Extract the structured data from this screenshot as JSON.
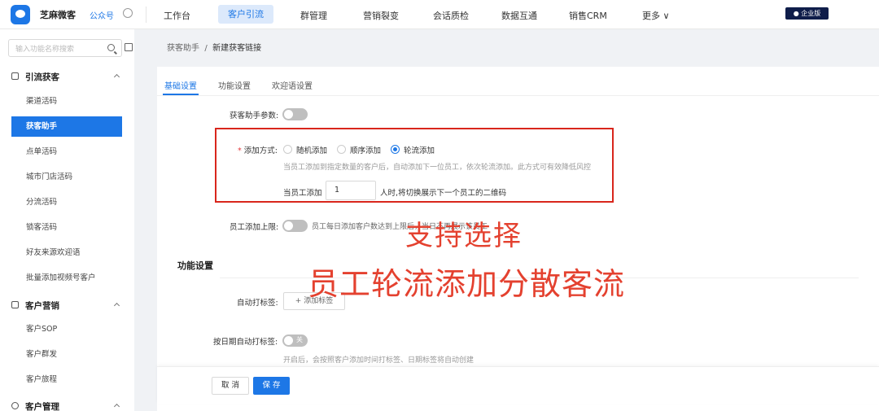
{
  "topbar": {
    "brand": "芝麻微客",
    "gzh": "公众号",
    "nav": [
      "工作台",
      "客户引流",
      "群管理",
      "营销裂变",
      "会话质检",
      "数据互通",
      "销售CRM",
      "更多 ∨"
    ],
    "badge": "企业版"
  },
  "sidebar": {
    "search_placeholder": "输入功能名称搜索",
    "group1": "引流获客",
    "group1_items": [
      "渠道活码",
      "获客助手",
      "点单活码",
      "城市门店活码",
      "分流活码",
      "锁客活码",
      "好友来源欢迎语",
      "批量添加视频号客户"
    ],
    "group2": "客户营销",
    "group2_items": [
      "客户SOP",
      "客户群发",
      "客户旅程"
    ],
    "group3": "客户管理"
  },
  "breadcrumb": {
    "parent": "获客助手",
    "sep": "/",
    "current": "新建获客链接"
  },
  "tabs": [
    "基础设置",
    "功能设置",
    "欢迎语设置"
  ],
  "form": {
    "param_label": "获客助手参数:",
    "add_mode_label": "添加方式:",
    "add_mode_options": [
      "随机添加",
      "顺序添加",
      "轮流添加"
    ],
    "add_mode_hint": "当员工添加到指定数量的客户后，自动添加下一位员工，依次轮流添加。此方式可有效降低风控",
    "switch_prefix": "当员工添加",
    "switch_value": "1",
    "switch_suffix": "人时,将切换展示下一个员工的二维码",
    "limit_label": "员工添加上限:",
    "limit_hint": "员工每日添加客户数达到上限后，当日不再展示该员工",
    "section_title": "功能设置",
    "auto_tag_label": "自动打标签:",
    "add_tag_button": "+ 添加标签",
    "date_tag_label": "按日期自动打标签:",
    "date_tag_toggle": "关",
    "date_tag_hint": "开启后，会按照客户添加时间打标签、日期标签将自动创建"
  },
  "overlay": {
    "line1": "支持选择",
    "line2": "员工轮流添加分散客流"
  },
  "footer": {
    "cancel": "取 消",
    "save": "保 存"
  }
}
